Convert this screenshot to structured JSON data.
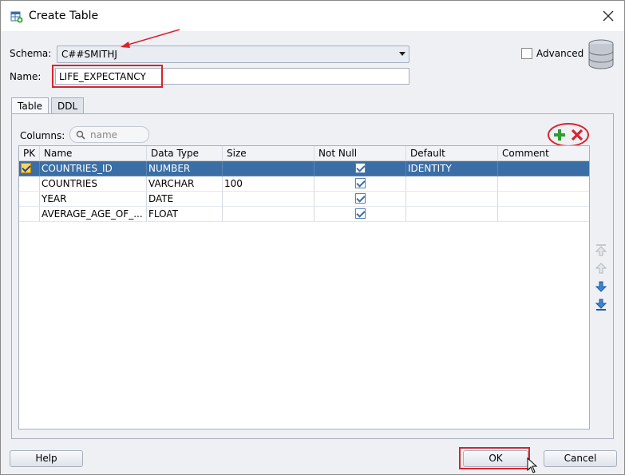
{
  "window": {
    "title": "Create Table"
  },
  "form": {
    "schema_label": "Schema:",
    "schema_value": "C##SMITHJ",
    "name_label": "Name:",
    "name_value": "LIFE_EXPECTANCY",
    "advanced_label": "Advanced",
    "advanced_checked": false
  },
  "tabs": [
    {
      "label": "Table",
      "active": true
    },
    {
      "label": "DDL",
      "active": false
    }
  ],
  "columns": {
    "label": "Columns:",
    "search_placeholder": "name",
    "headers": [
      "PK",
      "Name",
      "Data Type",
      "Size",
      "Not Null",
      "Default",
      "Comment"
    ],
    "rows": [
      {
        "pk": true,
        "name": "COUNTRIES_ID",
        "type": "NUMBER",
        "size": "",
        "not_null": true,
        "default": "IDENTITY",
        "comment": "",
        "selected": true
      },
      {
        "pk": false,
        "name": "COUNTRIES",
        "type": "VARCHAR",
        "size": "100",
        "not_null": true,
        "default": "",
        "comment": "",
        "selected": false
      },
      {
        "pk": false,
        "name": "YEAR",
        "type": "DATE",
        "size": "",
        "not_null": true,
        "default": "",
        "comment": "",
        "selected": false
      },
      {
        "pk": false,
        "name": "AVERAGE_AGE_OF_...",
        "type": "FLOAT",
        "size": "",
        "not_null": true,
        "default": "",
        "comment": "",
        "selected": false
      }
    ]
  },
  "buttons": {
    "help": "Help",
    "ok": "OK",
    "cancel": "Cancel"
  },
  "colors": {
    "accent": "#3a6ea5",
    "annotation": "#d9232d",
    "add": "#2e9e2e",
    "remove": "#d9232d"
  }
}
